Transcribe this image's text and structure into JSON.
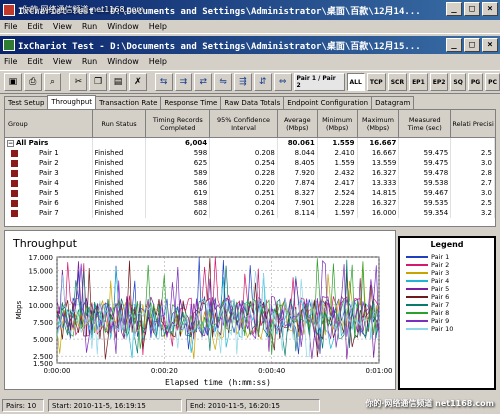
{
  "outer_window": {
    "title": "IxChariot Test - D:\\Documents and Settings\\Administrator\\桌面\\百款\\12月14...",
    "watermark": "你的·网络通信频道 net1168.com"
  },
  "menu": [
    "File",
    "Edit",
    "View",
    "Run",
    "Window",
    "Help"
  ],
  "inner_window": {
    "title": "IxChariot Test - D:\\Documents and Settings\\Administrator\\桌面\\百款\\12月15..."
  },
  "menu2": [
    "File",
    "Edit",
    "View",
    "Run",
    "Window",
    "Help"
  ],
  "toolbar_text_buttons": [
    "Pair 1 / Pair 2",
    "ALL",
    "TCP",
    "SCR",
    "EP1",
    "EP2",
    "SQ",
    "PG",
    "PC"
  ],
  "tabs": [
    "Test Setup",
    "Throughput",
    "Transaction Rate",
    "Response Time",
    "Raw Data Totals",
    "Endpoint Configuration",
    "Datagram"
  ],
  "active_tab": "Throughput",
  "table": {
    "headers": [
      "Group",
      "Run Status",
      "Timing Records Completed",
      "95% Confidence Interval",
      "Average (Mbps)",
      "Minimum (Mbps)",
      "Maximum (Mbps)",
      "Measured Time (sec)",
      "Relati Precisi"
    ],
    "all_pairs": {
      "group": "All Pairs",
      "records": "6,004",
      "average": "80.061",
      "minimum": "1.559",
      "maximum": "16.667"
    },
    "rows": [
      {
        "pair": "Pair 1",
        "status": "Finished",
        "records": "598",
        "ci": "0.208",
        "avg": "8.044",
        "min": "2.410",
        "max": "16.667",
        "time": "59.475",
        "prec": "2.5"
      },
      {
        "pair": "Pair 2",
        "status": "Finished",
        "records": "625",
        "ci": "0.254",
        "avg": "8.405",
        "min": "1.559",
        "max": "13.559",
        "time": "59.475",
        "prec": "3.0"
      },
      {
        "pair": "Pair 3",
        "status": "Finished",
        "records": "589",
        "ci": "0.228",
        "avg": "7.920",
        "min": "2.432",
        "max": "16.327",
        "time": "59.478",
        "prec": "2.8"
      },
      {
        "pair": "Pair 4",
        "status": "Finished",
        "records": "586",
        "ci": "0.220",
        "avg": "7.874",
        "min": "2.417",
        "max": "13.333",
        "time": "59.538",
        "prec": "2.7"
      },
      {
        "pair": "Pair 5",
        "status": "Finished",
        "records": "619",
        "ci": "0.251",
        "avg": "8.327",
        "min": "2.524",
        "max": "14.815",
        "time": "59.467",
        "prec": "3.0"
      },
      {
        "pair": "Pair 6",
        "status": "Finished",
        "records": "588",
        "ci": "0.204",
        "avg": "7.901",
        "min": "2.228",
        "max": "16.327",
        "time": "59.535",
        "prec": "2.5"
      },
      {
        "pair": "Pair 7",
        "status": "Finished",
        "records": "602",
        "ci": "0.261",
        "avg": "8.114",
        "min": "1.597",
        "max": "16.000",
        "time": "59.354",
        "prec": "3.2"
      }
    ]
  },
  "chart_data": {
    "type": "line",
    "title": "Throughput",
    "xlabel": "Elapsed time (h:mm:ss)",
    "ylabel": "Mbps",
    "ylim": [
      1.5,
      17.0
    ],
    "yticks": [
      "17.000",
      "15.000",
      "12.500",
      "10.000",
      "7.500",
      "5.000",
      "2.500",
      "1.500"
    ],
    "xticks": [
      "0:00:00",
      "0:00:20",
      "0:00:40",
      "0:01:00"
    ],
    "xlim": [
      0,
      60
    ],
    "grid": true,
    "series": [
      {
        "name": "Pair 1",
        "color": "#1f3fbf",
        "avg": 8.04,
        "seed": 1
      },
      {
        "name": "Pair 2",
        "color": "#d2186f",
        "avg": 8.4,
        "seed": 2
      },
      {
        "name": "Pair 3",
        "color": "#c8a400",
        "avg": 7.92,
        "seed": 3
      },
      {
        "name": "Pair 4",
        "color": "#1fb6d6",
        "avg": 7.87,
        "seed": 4
      },
      {
        "name": "Pair 5",
        "color": "#7a1f9e",
        "avg": 8.33,
        "seed": 5
      },
      {
        "name": "Pair 6",
        "color": "#6e1a1a",
        "avg": 7.9,
        "seed": 6
      },
      {
        "name": "Pair 7",
        "color": "#0a7a6a",
        "avg": 8.11,
        "seed": 7
      },
      {
        "name": "Pair 8",
        "color": "#2ca02c",
        "avg": 8.0,
        "seed": 8
      },
      {
        "name": "Pair 9",
        "color": "#7b2fbe",
        "avg": 8.0,
        "seed": 9
      },
      {
        "name": "Pair 10",
        "color": "#8fd6e8",
        "avg": 8.0,
        "seed": 10
      }
    ],
    "legend_title": "Legend"
  },
  "status": {
    "pairs": "Pairs: 10",
    "start": "Start: 2010-11-5, 16:19:15",
    "end": "End: 2010-11-5, 16:20:15",
    "watermark": "你的·网络通信频道 net1168.com"
  }
}
